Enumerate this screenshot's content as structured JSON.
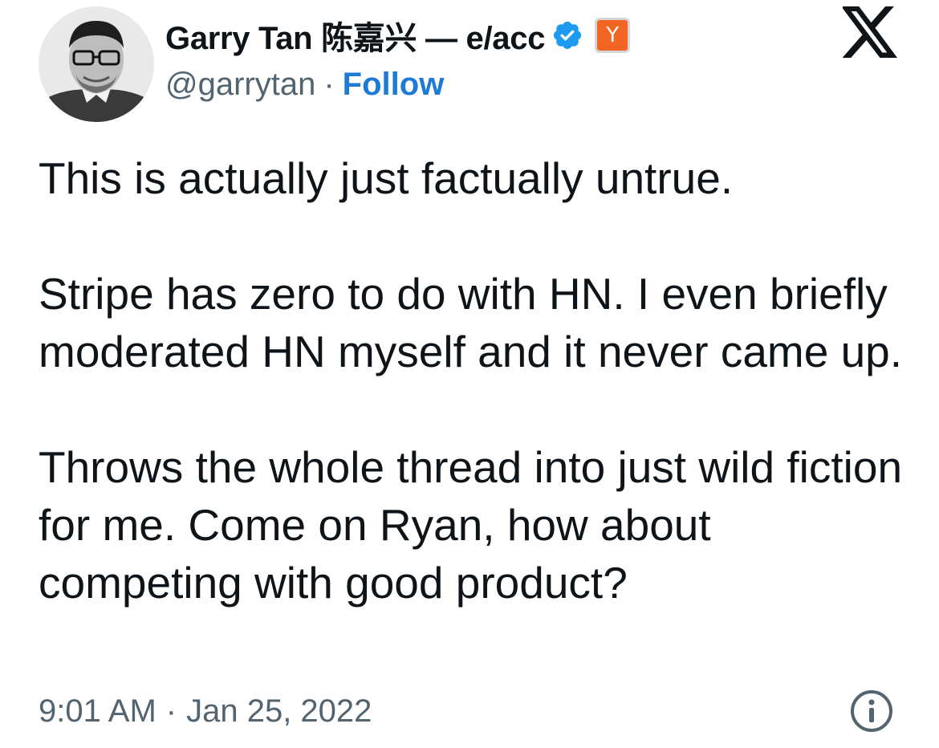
{
  "author": {
    "display_name": "Garry Tan 陈嘉兴 — e/acc",
    "handle": "@garrytan",
    "separator": "·",
    "follow_label": "Follow",
    "verified_icon": "verified-badge-icon",
    "affiliate_badge_label": "Y",
    "affiliate_badge_color": "#f26522",
    "verified_color": "#1d9bf0"
  },
  "platform_logo": "x-logo-icon",
  "tweet": {
    "paragraphs": [
      "This is actually just factually untrue.",
      "Stripe has zero to do with HN. I even briefly moderated HN myself and it never came up.",
      "Throws the whole thread into just wild fiction for me. Come on Ryan, how about competing with good product?"
    ]
  },
  "meta": {
    "time": "9:01 AM",
    "separator": "·",
    "date": "Jan 25, 2022",
    "info_icon": "info-icon"
  },
  "colors": {
    "text": "#0f1419",
    "secondary": "#536471",
    "link": "#1d7bd6"
  }
}
